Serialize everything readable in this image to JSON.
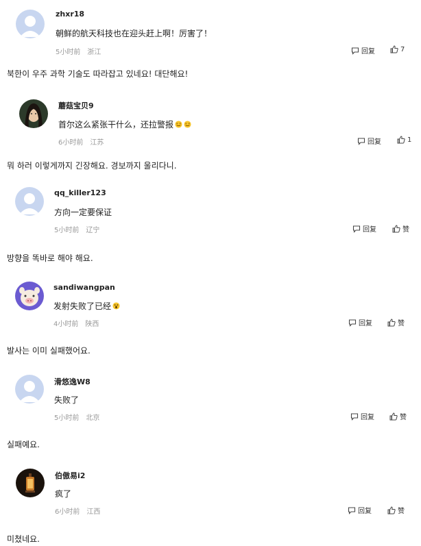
{
  "reply_label": "回复",
  "comments": [
    {
      "username": "zhxr18",
      "text": "朝鲜的航天科技也在迎头赶上啊！厉害了！",
      "time": "5小时前",
      "location": "浙江",
      "likes": "7",
      "avatar": "default-avatar",
      "translation": "북한이 우주 과학 기술도 따라잡고 있네요! 대단해요!"
    },
    {
      "username": "蘑菇宝贝9",
      "text": "首尔这么紧张干什么，还拉警报",
      "time": "6小时前",
      "location": "江苏",
      "likes": "1",
      "avatar": "woman-portrait",
      "translation": "뭐 하러 이렇게까지 긴장해요. 경보까지 울리다니."
    },
    {
      "username": "qq_killer123",
      "text": "方向一定要保证",
      "time": "5小时前",
      "location": "辽宁",
      "likes": "赞",
      "avatar": "default-avatar",
      "translation": "방향을 똑바로 해야 해요."
    },
    {
      "username": "sandiwangpan",
      "text": "发射失败了已经",
      "time": "4小时前",
      "location": "陕西",
      "likes": "赞",
      "avatar": "cartoon-pig",
      "translation": "발사는 이미 실패했어요."
    },
    {
      "username": "滑悠逸W8",
      "text": "失败了",
      "time": "5小时前",
      "location": "北京",
      "likes": "赞",
      "avatar": "default-avatar",
      "translation": "실패예요."
    },
    {
      "username": "伯傲易i2",
      "text": "疯了",
      "time": "6小时前",
      "location": "江西",
      "likes": "赞",
      "avatar": "lantern-photo",
      "translation": "미쳤네요."
    }
  ]
}
